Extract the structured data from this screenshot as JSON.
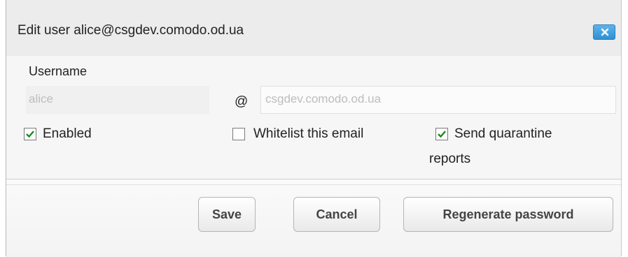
{
  "dialog": {
    "title": "Edit user alice@csgdev.comodo.od.ua"
  },
  "form": {
    "username_label": "Username",
    "username_value": "alice",
    "at_sign": "@",
    "domain_value": "csgdev.comodo.od.ua",
    "enabled": {
      "label": "Enabled",
      "checked": true
    },
    "whitelist": {
      "label": "Whitelist this email",
      "checked": false
    },
    "quarantine": {
      "label_line1": "Send quarantine",
      "label_line2": "reports",
      "checked": true
    }
  },
  "buttons": {
    "save": "Save",
    "cancel": "Cancel",
    "regenerate": "Regenerate password"
  },
  "colors": {
    "close_button": "#2f8fd6",
    "checkmark": "#1a8a1a"
  }
}
